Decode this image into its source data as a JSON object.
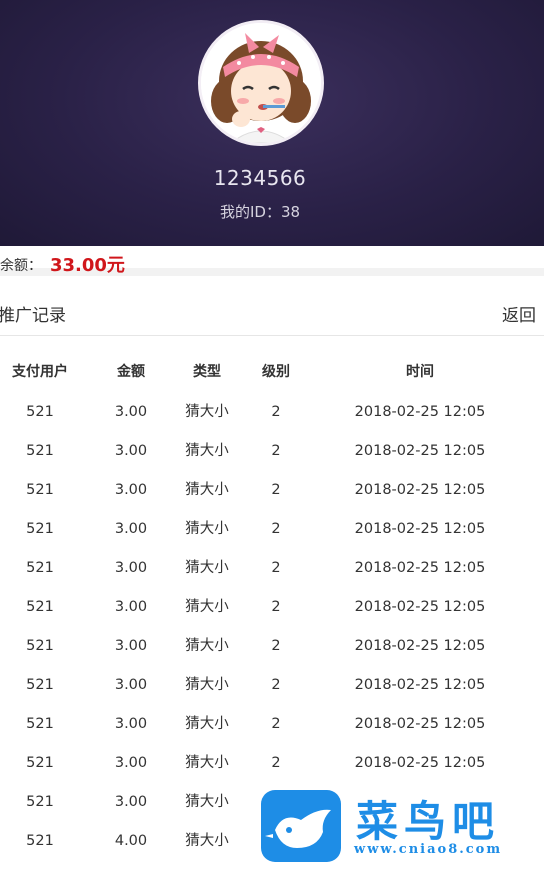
{
  "profile": {
    "avatar_icon": "cartoon-girl-avatar",
    "username": "1234566",
    "id_text": "我的ID：38"
  },
  "balance": {
    "label": "余额：",
    "value": "33.00元",
    "value_color": "#d0161b"
  },
  "records": {
    "title": "推广记录",
    "back_label": "返回",
    "columns": [
      "支付用户",
      "金额",
      "类型",
      "级别",
      "时间"
    ],
    "rows": [
      [
        "521",
        "3.00",
        "猜大小",
        "2",
        "2018-02-25 12:05"
      ],
      [
        "521",
        "3.00",
        "猜大小",
        "2",
        "2018-02-25 12:05"
      ],
      [
        "521",
        "3.00",
        "猜大小",
        "2",
        "2018-02-25 12:05"
      ],
      [
        "521",
        "3.00",
        "猜大小",
        "2",
        "2018-02-25 12:05"
      ],
      [
        "521",
        "3.00",
        "猜大小",
        "2",
        "2018-02-25 12:05"
      ],
      [
        "521",
        "3.00",
        "猜大小",
        "2",
        "2018-02-25 12:05"
      ],
      [
        "521",
        "3.00",
        "猜大小",
        "2",
        "2018-02-25 12:05"
      ],
      [
        "521",
        "3.00",
        "猜大小",
        "2",
        "2018-02-25 12:05"
      ],
      [
        "521",
        "3.00",
        "猜大小",
        "2",
        "2018-02-25 12:05"
      ],
      [
        "521",
        "3.00",
        "猜大小",
        "2",
        "2018-02-25 12:05"
      ],
      [
        "521",
        "3.00",
        "猜大小",
        "",
        ""
      ],
      [
        "521",
        "4.00",
        "猜大小",
        "",
        ""
      ]
    ]
  },
  "watermark": {
    "logo_icon": "bird-logo-icon",
    "text": "菜鸟吧",
    "url": "www.cniao8.com",
    "color": "#1e8de6"
  }
}
